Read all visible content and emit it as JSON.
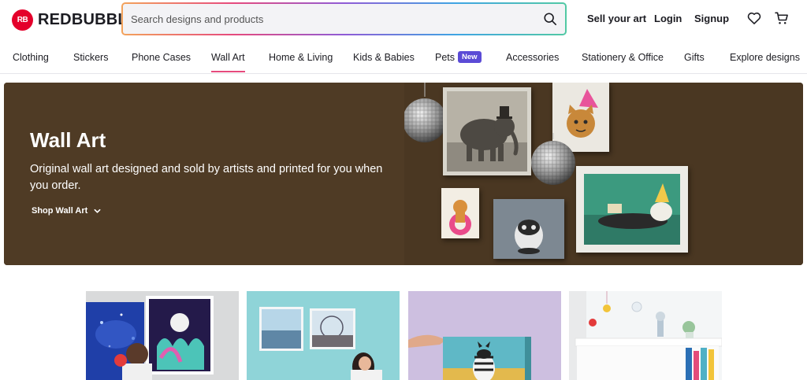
{
  "brand": {
    "logo_badge": "RB",
    "logo_text": "REDBUBBLE"
  },
  "search": {
    "placeholder": "Search designs and products"
  },
  "header": {
    "sell_label": "Sell your art",
    "login_label": "Login",
    "signup_label": "Signup"
  },
  "nav": {
    "items": [
      {
        "label": "Clothing"
      },
      {
        "label": "Stickers"
      },
      {
        "label": "Phone Cases"
      },
      {
        "label": "Wall Art"
      },
      {
        "label": "Home & Living"
      },
      {
        "label": "Kids & Babies"
      },
      {
        "label": "Pets"
      },
      {
        "label": "Accessories"
      },
      {
        "label": "Stationery & Office"
      },
      {
        "label": "Gifts"
      },
      {
        "label": "Explore designs"
      }
    ],
    "active": "Wall Art",
    "pets_badge": "New"
  },
  "hero": {
    "title": "Wall Art",
    "subtitle": "Original wall art designed and sold by artists and printed for you when you order.",
    "cta_label": "Shop Wall Art"
  },
  "colors": {
    "brand_red": "#e4002b",
    "hero_brown": "#4f3b25",
    "badge_purple": "#5b4bd6",
    "active_underline": "#e64a7d"
  },
  "icons": [
    "search-icon",
    "heart-icon",
    "cart-icon",
    "chevron-down-icon"
  ]
}
